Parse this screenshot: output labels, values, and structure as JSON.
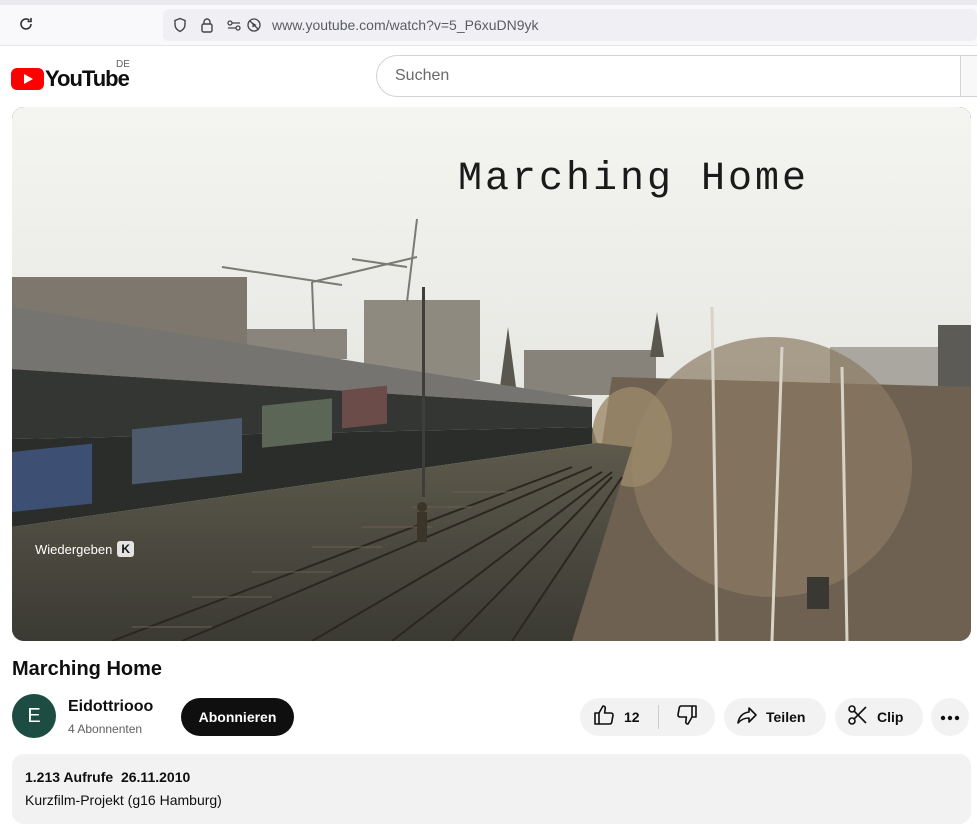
{
  "browser": {
    "url": "www.youtube.com/watch?v=5_P6xuDN9yk"
  },
  "header": {
    "logo_text": "YouTube",
    "country_code": "DE",
    "search_placeholder": "Suchen"
  },
  "player": {
    "overlay_title": "Marching Home",
    "tooltip_label": "Wiedergeben",
    "tooltip_key": "K"
  },
  "video": {
    "title": "Marching Home",
    "channel": {
      "avatar_letter": "E",
      "name": "Eidottriooo",
      "subscribers": "4 Abonnenten"
    },
    "subscribe_label": "Abonnieren",
    "likes": "12",
    "share_label": "Teilen",
    "clip_label": "Clip"
  },
  "description": {
    "views": "1.213 Aufrufe",
    "date": "26.11.2010",
    "text": "Kurzfilm-Projekt (g16 Hamburg)"
  },
  "colors": {
    "brand_red": "#ff0000",
    "avatar_bg": "#1d4d42"
  }
}
